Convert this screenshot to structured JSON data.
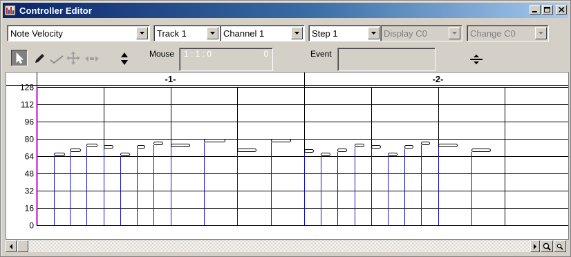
{
  "window": {
    "title": "Controller Editor"
  },
  "toolbar": {
    "controller": "Note Velocity",
    "track": "Track 1",
    "channel": "Channel 1",
    "step": "Step 1",
    "display": "Display C0",
    "change": "Change C0",
    "mouse_label": "Mouse",
    "mouse_position": "1 : 1 : 0",
    "mouse_value": "0",
    "event_label": "Event",
    "event_value": ""
  },
  "tools": [
    "arrow-tool",
    "pencil-tool",
    "line-tool",
    "move-tool",
    "stretch-tool",
    "updown-tool"
  ],
  "graph": {
    "y_ticks": [
      128,
      112,
      96,
      80,
      64,
      48,
      32,
      16,
      0
    ],
    "measures": [
      "-1-",
      "-2-"
    ]
  },
  "chart_data": {
    "type": "bar",
    "title": "",
    "xlabel": "",
    "ylabel": "",
    "ylim": [
      0,
      128
    ],
    "measures": [
      "-1-",
      "-2-"
    ],
    "beats_per_measure": 4,
    "events": [
      {
        "measure": 1,
        "beat": 1.26,
        "velocity": 66,
        "length": 0.15
      },
      {
        "measure": 1,
        "beat": 1.5,
        "velocity": 70,
        "length": 0.15
      },
      {
        "measure": 1,
        "beat": 1.74,
        "velocity": 74,
        "length": 0.15
      },
      {
        "measure": 1,
        "beat": 2.0,
        "velocity": 73,
        "length": 0.13
      },
      {
        "measure": 1,
        "beat": 2.25,
        "velocity": 66,
        "length": 0.13
      },
      {
        "measure": 1,
        "beat": 2.5,
        "velocity": 73,
        "length": 0.11
      },
      {
        "measure": 1,
        "beat": 2.75,
        "velocity": 76,
        "length": 0.13
      },
      {
        "measure": 1,
        "beat": 3.0,
        "velocity": 74,
        "length": 0.28
      },
      {
        "measure": 1,
        "beat": 3.5,
        "velocity": 79,
        "length": 0.31
      },
      {
        "measure": 1,
        "beat": 4.0,
        "velocity": 70,
        "length": 0.28
      },
      {
        "measure": 1,
        "beat": 4.5,
        "velocity": 79,
        "length": 0.29
      },
      {
        "measure": 2,
        "beat": 1.0,
        "velocity": 69,
        "length": 0.13
      },
      {
        "measure": 2,
        "beat": 1.25,
        "velocity": 66,
        "length": 0.13
      },
      {
        "measure": 2,
        "beat": 1.5,
        "velocity": 70,
        "length": 0.13
      },
      {
        "measure": 2,
        "beat": 1.75,
        "velocity": 74,
        "length": 0.13
      },
      {
        "measure": 2,
        "beat": 2.0,
        "velocity": 73,
        "length": 0.13
      },
      {
        "measure": 2,
        "beat": 2.25,
        "velocity": 66,
        "length": 0.13
      },
      {
        "measure": 2,
        "beat": 2.5,
        "velocity": 73,
        "length": 0.12
      },
      {
        "measure": 2,
        "beat": 2.75,
        "velocity": 76,
        "length": 0.12
      },
      {
        "measure": 2,
        "beat": 3.0,
        "velocity": 74,
        "length": 0.28
      },
      {
        "measure": 2,
        "beat": 3.5,
        "velocity": 70,
        "length": 0.28
      }
    ]
  },
  "colors": {
    "stem": "#1010c8",
    "grid": "#000000",
    "playhead": "#c000c0",
    "titlebar_start": "#0a246a",
    "titlebar_end": "#a6caf0"
  }
}
